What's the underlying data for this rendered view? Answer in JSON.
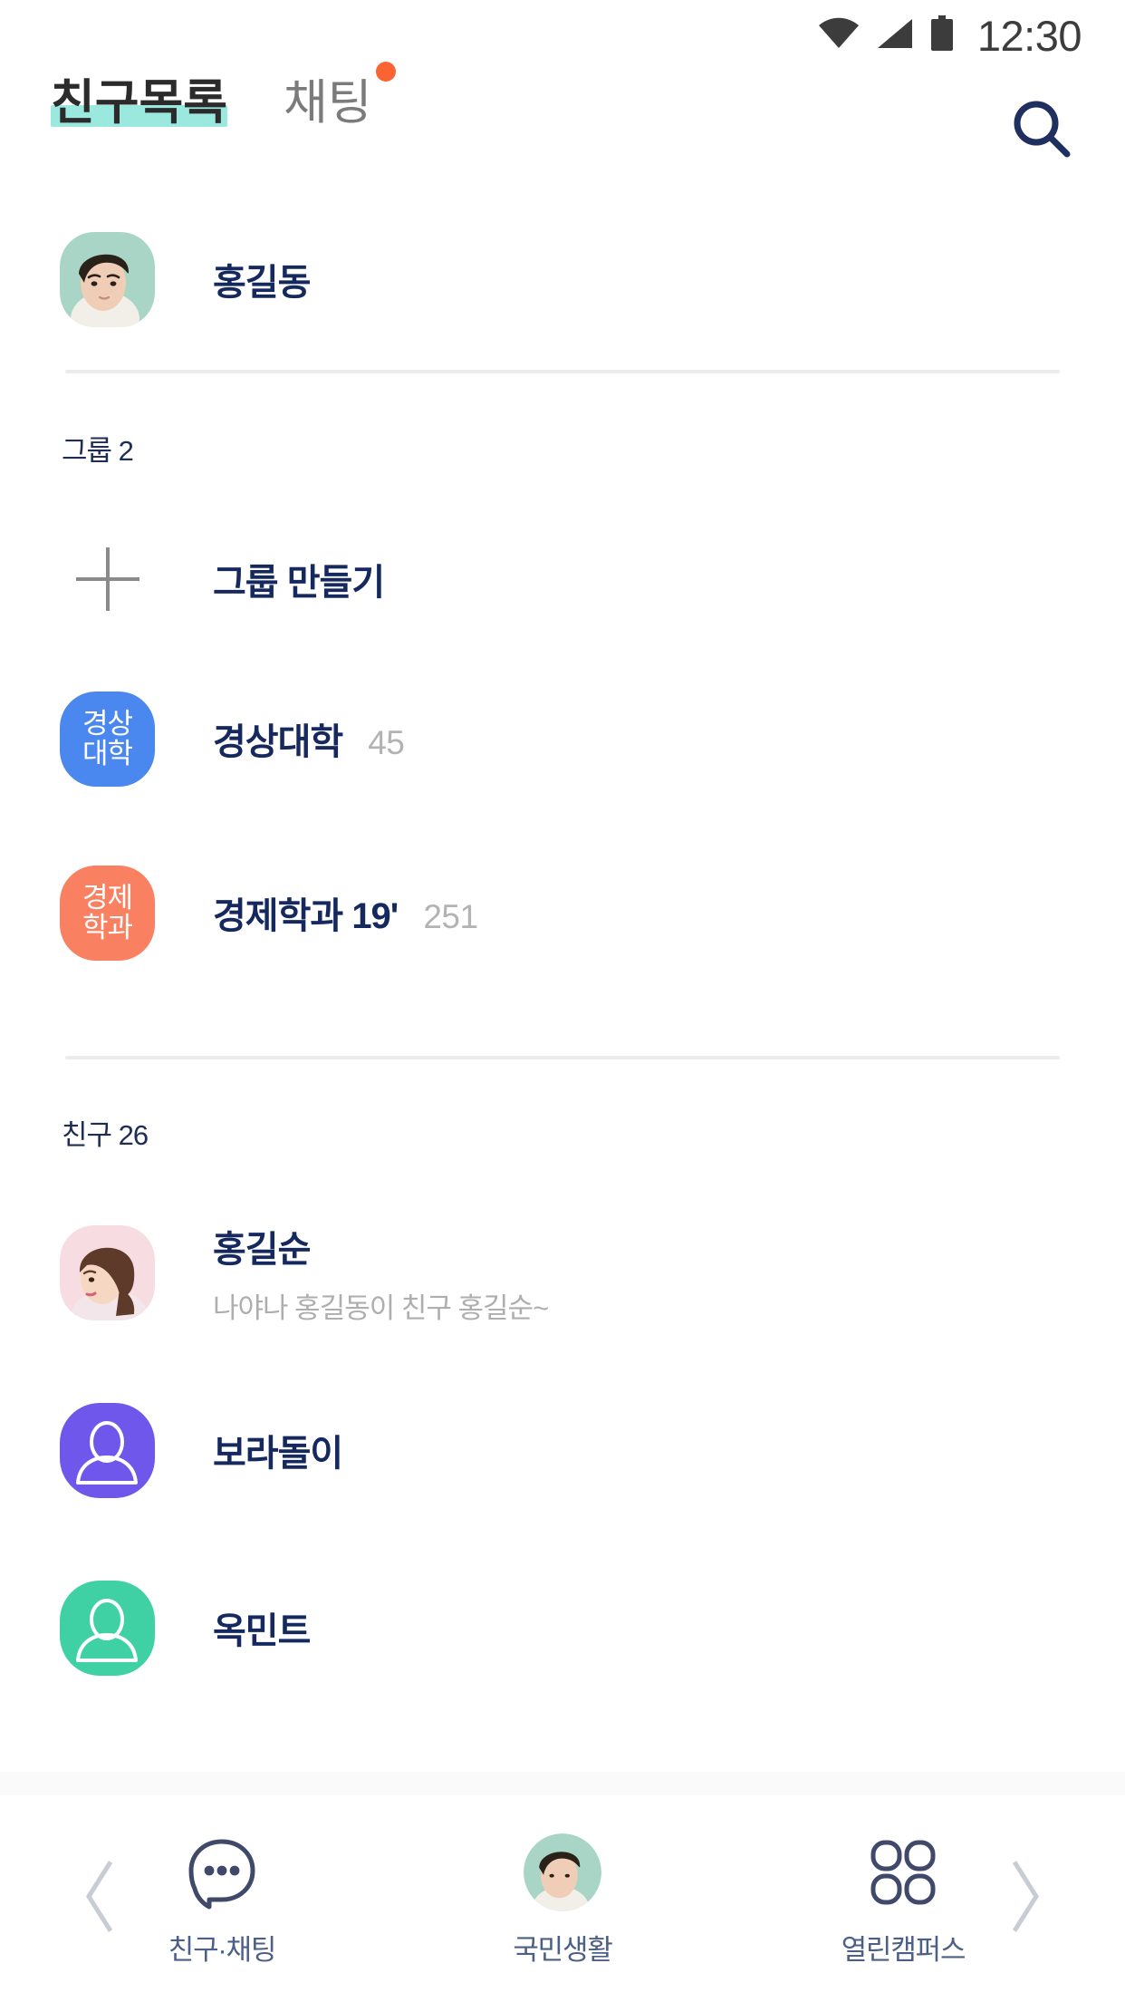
{
  "status_bar": {
    "time": "12:30",
    "icons": [
      "wifi-icon",
      "signal-icon",
      "battery-icon"
    ]
  },
  "header": {
    "tabs": [
      {
        "label": "친구목록",
        "active": true,
        "has_dot": false
      },
      {
        "label": "채팅",
        "active": false,
        "has_dot": true
      }
    ],
    "search_label": "search-icon"
  },
  "me": {
    "name": "홍길동",
    "avatar": "photo-male-mint"
  },
  "groups_section": {
    "header_label": "그룹",
    "header_count": "2",
    "create_label": "그룹 만들기",
    "items": [
      {
        "badge_line1": "경상",
        "badge_line2": "대학",
        "title": "경상대학",
        "count": "45",
        "color": "#4a87ee"
      },
      {
        "badge_line1": "경제",
        "badge_line2": "학과",
        "title": "경제학과 19'",
        "count": "251",
        "color": "#f98060"
      }
    ]
  },
  "friends_section": {
    "header_label": "친구",
    "header_count": "26",
    "items": [
      {
        "name": "홍길순",
        "status": "나야나 홍길동이 친구 홍길순~",
        "avatar": "photo-female-pink",
        "color": "#f6d8dc"
      },
      {
        "name": "보라돌이",
        "status": "",
        "avatar": "person-icon",
        "color": "#7057ec"
      },
      {
        "name": "옥민트",
        "status": "",
        "avatar": "person-icon",
        "color": "#3fd1a4"
      }
    ]
  },
  "bottom_nav": {
    "prev_label": "chevron-left-icon",
    "next_label": "chevron-right-icon",
    "items": [
      {
        "label": "친구·채팅",
        "icon": "chat-bubble-icon"
      },
      {
        "label": "국민생활",
        "icon": "avatar-icon"
      },
      {
        "label": "열린캠퍼스",
        "icon": "grid-four-icon"
      }
    ]
  },
  "colors": {
    "accent_mint": "#9ae8de",
    "accent_orange": "#fa6432",
    "navy": "#15295e",
    "muted": "#b3b3b3",
    "divider": "#ececec"
  }
}
